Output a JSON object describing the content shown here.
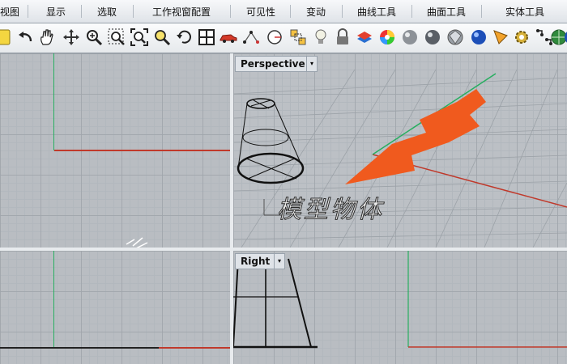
{
  "menu_tabs": [
    "视图",
    "显示",
    "选取",
    "工作视窗配置",
    "可见性",
    "变动",
    "曲线工具",
    "曲面工具",
    "实体工具"
  ],
  "toolbar_icons": [
    "note-icon",
    "undo-icon",
    "pan-hand-icon",
    "rotate-view-icon",
    "zoom-icon",
    "zoom-window-icon",
    "zoom-extents-icon",
    "zoom-selected-icon",
    "undo-view-icon",
    "four-viewports-icon",
    "car-icon",
    "select-points-icon",
    "circle-icon",
    "group-icon",
    "light-bulb-icon",
    "lock-icon",
    "layer-icon",
    "color-wheel-icon",
    "material-sphere-icon",
    "render-sphere-icon",
    "gem-sphere-icon",
    "blue-sphere-icon",
    "dimension-icon",
    "gear-icon",
    "dot-grid-icon",
    "globe-icon",
    "edge-sphere-icon"
  ],
  "viewports": {
    "perspective": {
      "label": "Perspective",
      "dropdown": "▾"
    },
    "right": {
      "label": "Right",
      "dropdown": "▾"
    }
  },
  "annotation_text": "模型物体",
  "colors": {
    "arrow": "#f05a1e",
    "x_axis": "#c0392b",
    "y_axis": "#27ae60"
  }
}
